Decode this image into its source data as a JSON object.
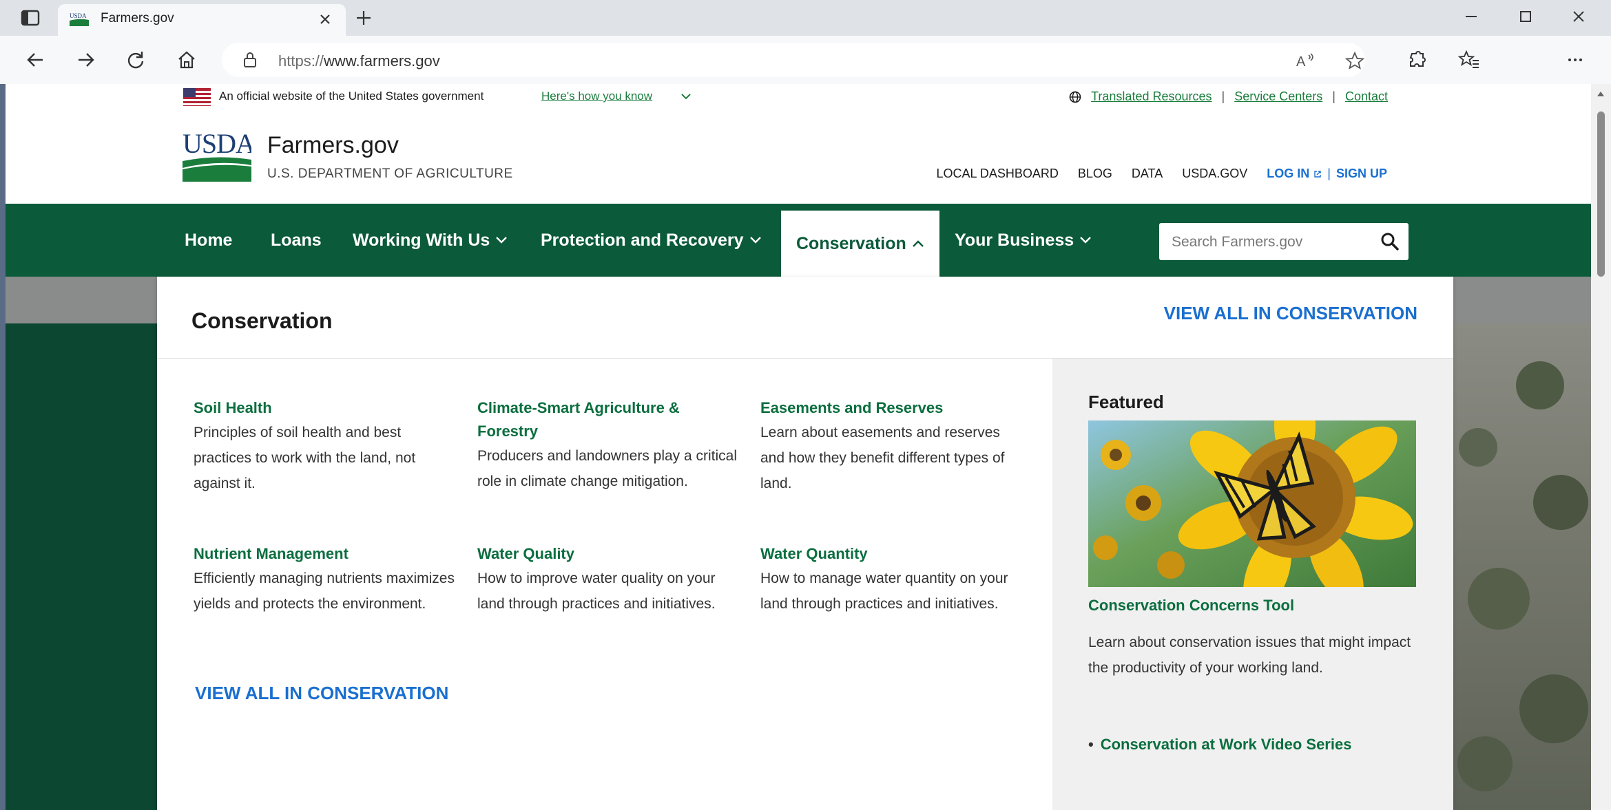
{
  "browser": {
    "tab_title": "Farmers.gov",
    "favicon_text": "USDA",
    "url_protocol": "https://",
    "url_host": "www.farmers.gov"
  },
  "gov_banner": {
    "text": "An official website of the United States government",
    "link": "Here's how you know",
    "translated": "Translated Resources",
    "sep1": "|",
    "service_centers": "Service Centers",
    "sep2": "|",
    "contact": "Contact"
  },
  "header": {
    "logo_text": "USDA",
    "site_name": "Farmers.gov",
    "site_sub": "U.S. DEPARTMENT OF AGRICULTURE",
    "util_nav": {
      "local_dashboard": "LOCAL DASHBOARD",
      "blog": "BLOG",
      "data": "DATA",
      "usda_gov": "USDA.GOV",
      "login": "LOG IN",
      "pipe": "|",
      "signup": "SIGN UP"
    }
  },
  "nav": {
    "home": "Home",
    "loans": "Loans",
    "working": "Working With Us",
    "protection": "Protection and Recovery",
    "conservation": "Conservation",
    "business": "Your Business"
  },
  "search": {
    "placeholder": "Search Farmers.gov"
  },
  "mega": {
    "title": "Conservation",
    "view_all": "VIEW ALL IN CONSERVATION",
    "items": [
      {
        "title": "Soil Health",
        "desc": "Principles of soil health and best practices to work with the land, not against it."
      },
      {
        "title": "Climate-Smart Agriculture & Forestry",
        "desc": "Producers and landowners play a critical role in climate change mitigation."
      },
      {
        "title": "Easements and Reserves",
        "desc": "Learn about easements and reserves and how they benefit different types of land."
      },
      {
        "title": "Nutrient Management",
        "desc": "Efficiently managing nutrients maximizes yields and protects the environment."
      },
      {
        "title": "Water Quality",
        "desc": "How to improve water quality on your land through practices and initiatives."
      },
      {
        "title": "Water Quantity",
        "desc": "How to manage water quantity on your land through practices and initiatives."
      }
    ],
    "featured": {
      "label": "Featured",
      "title": "Conservation Concerns Tool",
      "desc": "Learn about conservation issues that might impact the productivity of your working land.",
      "bullet": "•",
      "link": "Conservation at Work Video Series"
    }
  }
}
